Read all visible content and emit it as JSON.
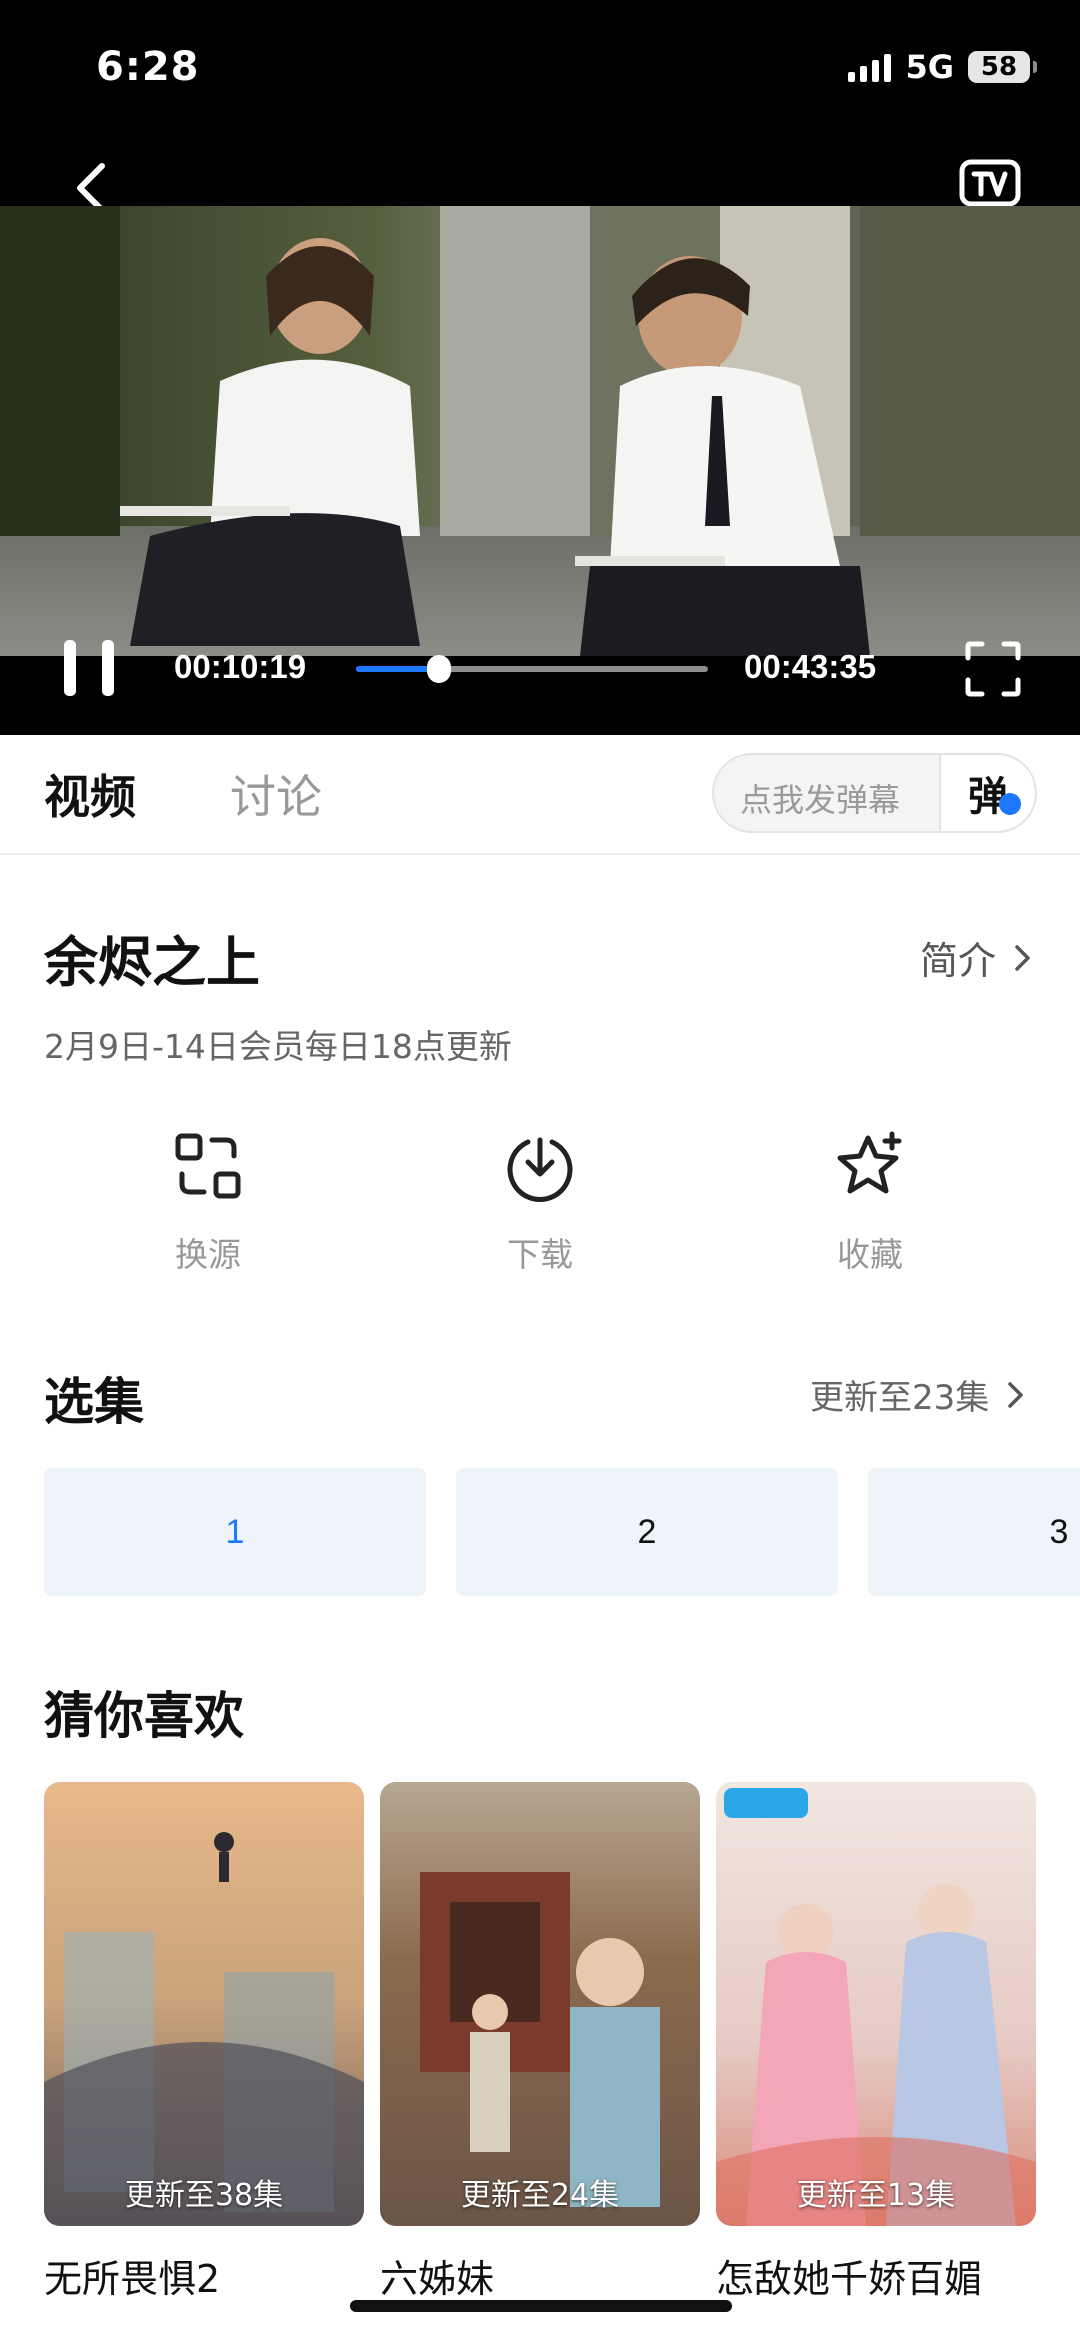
{
  "status_bar": {
    "time": "6:28",
    "network": "5G",
    "battery": "58"
  },
  "player": {
    "current_time": "00:10:19",
    "total_time": "00:43:35",
    "progress_fraction": 0.237,
    "accent_color": "#1e78ff"
  },
  "tabs": [
    {
      "label": "视频",
      "active": true
    },
    {
      "label": "讨论",
      "active": false
    }
  ],
  "danmu": {
    "placeholder": "点我发弹幕",
    "toggle_label": "弹"
  },
  "show": {
    "title": "余烬之上",
    "intro_label": "简介",
    "update_note": "2月9日-14日会员每日18点更新"
  },
  "actions": [
    {
      "label": "换源",
      "icon": "switch-source-icon"
    },
    {
      "label": "下载",
      "icon": "download-icon"
    },
    {
      "label": "收藏",
      "icon": "favorite-star-icon"
    }
  ],
  "episodes": {
    "title": "选集",
    "more_label": "更新至23集",
    "items": [
      "1",
      "2",
      "3"
    ],
    "selected": "1"
  },
  "recommendations": {
    "title": "猜你喜欢",
    "items": [
      {
        "name": "无所畏惧2",
        "badge": "更新至38集"
      },
      {
        "name": "六姊妹",
        "badge": "更新至24集"
      },
      {
        "name": "怎敌她千娇百媚",
        "badge": "更新至13集"
      }
    ]
  }
}
